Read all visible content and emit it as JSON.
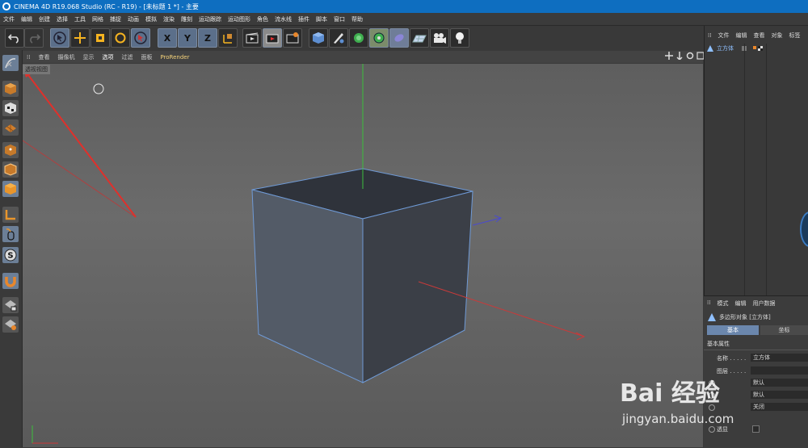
{
  "title_bar": {
    "text": "CINEMA 4D R19.068 Studio (RC - R19) - [未标题 1 *] - 主要"
  },
  "menu": [
    "文件",
    "编辑",
    "创建",
    "选择",
    "工具",
    "网格",
    "捕捉",
    "动画",
    "模拟",
    "渲染",
    "雕刻",
    "运动跟踪",
    "运动图形",
    "角色",
    "流水线",
    "插件",
    "脚本",
    "窗口",
    "帮助"
  ],
  "toolbar": {
    "x_label": "X",
    "y_label": "Y",
    "z_label": "Z"
  },
  "viewport_menu": [
    "查看",
    "摄像机",
    "显示",
    "选项",
    "过滤",
    "面板",
    "ProRender"
  ],
  "viewport_label": "透视视图",
  "object_manager": {
    "menu": [
      "文件",
      "编辑",
      "查看",
      "对象",
      "标签"
    ],
    "object_name": "立方体"
  },
  "attribute_manager": {
    "menu": [
      "模式",
      "编辑",
      "用户数据"
    ],
    "object_title": "多边形对象 [立方体]",
    "tabs": [
      "基本",
      "坐标"
    ],
    "section": "基本属性",
    "name_label": "名称 . . . . .",
    "name_value": "立方体",
    "layer_label": "图层 . . . . .",
    "default_1": "默认",
    "default_2": "默认",
    "off_value": "关闭",
    "transparency_label": "透显"
  },
  "watermark": {
    "main": "Bai 经验",
    "url": "jingyan.baidu.com"
  },
  "colors": {
    "accent": "#0e6ec0",
    "cube_edge": "#6f9ad6",
    "arrow": "#e0302b"
  }
}
